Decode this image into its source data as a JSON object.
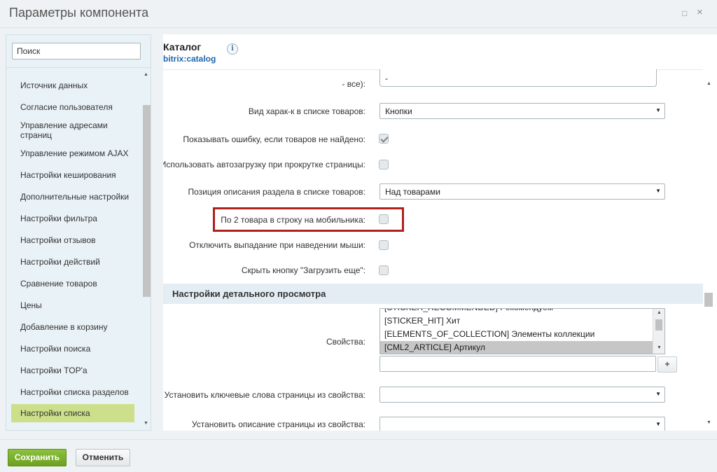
{
  "window": {
    "title": "Параметры компонента",
    "restore_icon": "□",
    "close_icon": "×"
  },
  "sidebar": {
    "search_placeholder": "Поиск",
    "items": [
      {
        "label": "Источник данных"
      },
      {
        "label": "Согласие пользователя"
      },
      {
        "label": "Управление адресами страниц"
      },
      {
        "label": "Управление режимом AJAX"
      },
      {
        "label": "Настройки кеширования"
      },
      {
        "label": "Дополнительные настройки"
      },
      {
        "label": "Настройки фильтра"
      },
      {
        "label": "Настройки отзывов"
      },
      {
        "label": "Настройки действий"
      },
      {
        "label": "Сравнение товаров"
      },
      {
        "label": "Цены"
      },
      {
        "label": "Добавление в корзину"
      },
      {
        "label": "Настройки поиска"
      },
      {
        "label": "Настройки TOP'а"
      },
      {
        "label": "Настройки списка разделов"
      },
      {
        "label": "Настройки списка",
        "active": true
      }
    ]
  },
  "component": {
    "title": "Каталог",
    "code": "bitrix:catalog",
    "info_icon": "i"
  },
  "properties": [
    {
      "label": "- все):",
      "type": "select-partial",
      "value": "-"
    },
    {
      "label": "Вид харак-к в списке товаров:",
      "type": "select",
      "value": "Кнопки"
    },
    {
      "label": "Показывать ошибку, если товаров не найдено:",
      "type": "checkbox",
      "checked": true
    },
    {
      "label": "Использовать автозагрузку при прокрутке страницы:",
      "type": "checkbox",
      "checked": false
    },
    {
      "label": "Позиция описания раздела в списке товаров:",
      "type": "select",
      "value": "Над товарами"
    },
    {
      "label": "По 2 товара в строку на мобильника:",
      "type": "checkbox",
      "checked": false,
      "highlighted": true
    },
    {
      "label": "Отключить выпадание при наведении мыши:",
      "type": "checkbox",
      "checked": false
    },
    {
      "label": "Скрыть кнопку \"Загрузить еще\":",
      "type": "checkbox",
      "checked": false
    }
  ],
  "detail_section": {
    "title": "Настройки детального просмотра",
    "properties_label": "Свойства:",
    "properties_options": [
      {
        "label": "[STICKER_RECOMMENDED] Рекомендуем",
        "selected": false
      },
      {
        "label": "[STICKER_HIT] Хит",
        "selected": false
      },
      {
        "label": "[ELEMENTS_OF_COLLECTION] Элементы коллекции",
        "selected": false
      },
      {
        "label": "[CML2_ARTICLE] Артикул",
        "selected": true
      }
    ],
    "add_button": "+",
    "keywords_label": "Установить ключевые слова страницы из свойства:",
    "keywords_value": "",
    "description_label": "Установить описание страницы из свойства:",
    "description_value": ""
  },
  "footer": {
    "save": "Сохранить",
    "cancel": "Отменить"
  },
  "colors": {
    "accent_green": "#6da01f",
    "active_item": "#cddf8a",
    "highlight_border": "#b0201d",
    "link_blue": "#2067b0"
  }
}
